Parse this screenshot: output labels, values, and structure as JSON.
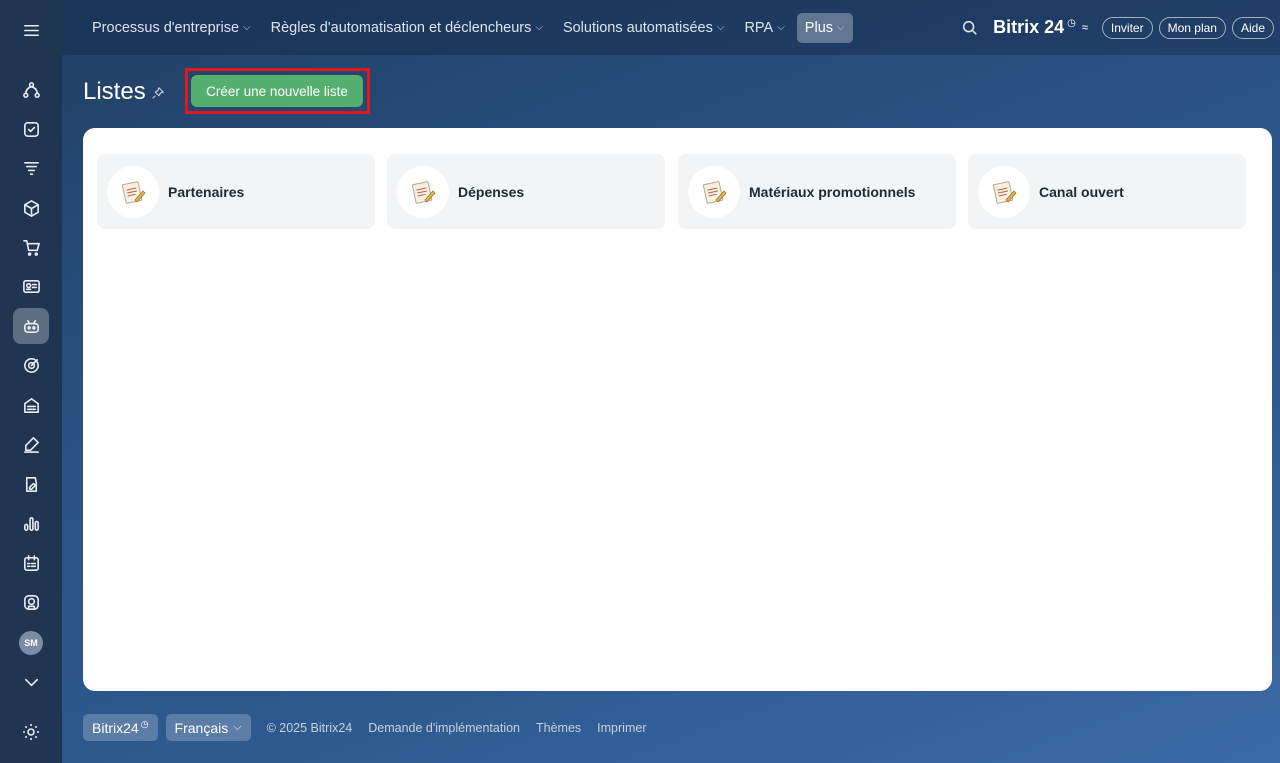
{
  "topbar": {
    "nav": [
      {
        "label": "Processus d'entreprise",
        "active": false
      },
      {
        "label": "Règles d'automatisation et déclencheurs",
        "active": false
      },
      {
        "label": "Solutions automatisées",
        "active": false
      },
      {
        "label": "RPA",
        "active": false
      },
      {
        "label": "Plus",
        "active": true
      }
    ],
    "brand": "Bitrix 24",
    "brand_clock": "◷",
    "brand_tune": "≈",
    "invite_label": "Inviter",
    "plan_label": "Mon plan",
    "help_label": "Aide"
  },
  "sidebar": {
    "items": [
      {
        "icon": "flow-icon"
      },
      {
        "icon": "task-check-icon"
      },
      {
        "icon": "funnel-icon"
      },
      {
        "icon": "box-icon"
      },
      {
        "icon": "cart-icon"
      },
      {
        "icon": "contact-card-icon"
      },
      {
        "icon": "robot-icon",
        "active": true
      },
      {
        "icon": "target-icon"
      },
      {
        "icon": "warehouse-icon"
      },
      {
        "icon": "sign-pen-icon"
      },
      {
        "icon": "document-edit-icon"
      },
      {
        "icon": "bar-chart-icon"
      },
      {
        "icon": "calendar-list-icon"
      },
      {
        "icon": "market-icon"
      }
    ],
    "avatar_initials": "SM",
    "more_icon": "chevron-down-icon",
    "settings_icon": "gear-icon"
  },
  "page": {
    "title": "Listes",
    "create_button": "Créer une nouvelle liste"
  },
  "lists": [
    {
      "label": "Partenaires"
    },
    {
      "label": "Dépenses"
    },
    {
      "label": "Matériaux promotionnels"
    },
    {
      "label": "Canal ouvert"
    }
  ],
  "footer": {
    "brand": "Bitrix24",
    "brand_clock": "◷",
    "language": "Français",
    "copyright": "© 2025 Bitrix24",
    "links": [
      "Demande d'implémentation",
      "Thèmes",
      "Imprimer"
    ]
  }
}
